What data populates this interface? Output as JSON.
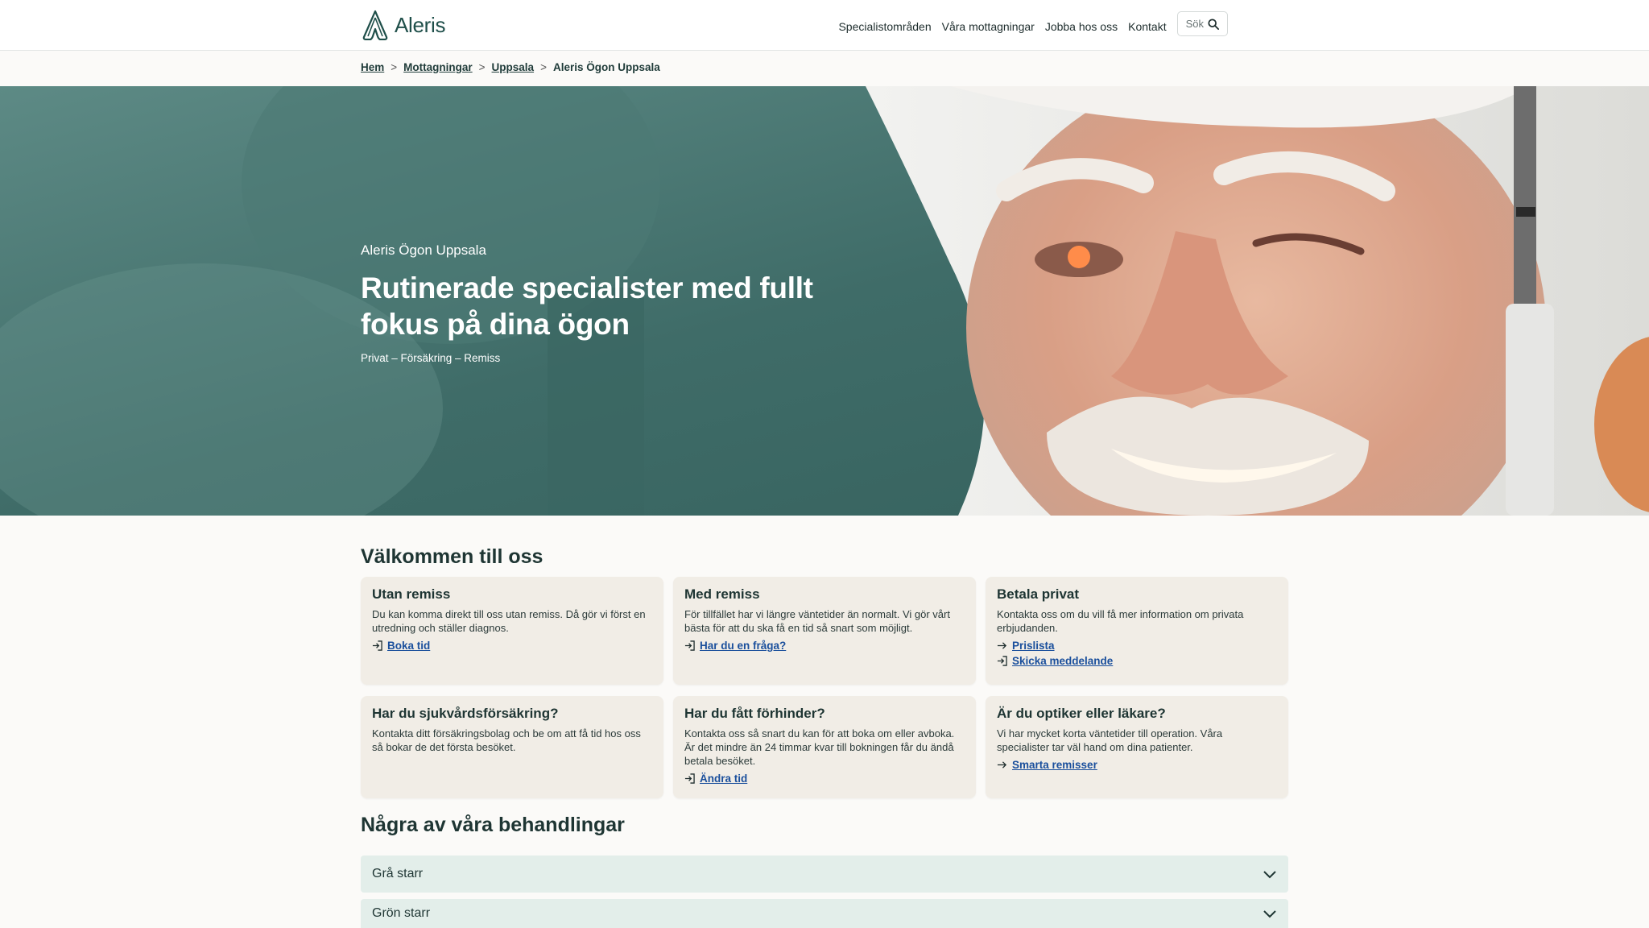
{
  "header": {
    "brand": "Aleris",
    "nav": [
      "Specialistområden",
      "Våra mottagningar",
      "Jobba hos oss",
      "Kontakt"
    ],
    "search_label": "Sök"
  },
  "breadcrumb": {
    "items": [
      "Hem",
      "Mottagningar",
      "Uppsala"
    ],
    "current": "Aleris Ögon Uppsala",
    "separator": ">"
  },
  "hero": {
    "eyebrow": "Aleris Ögon Uppsala",
    "title": "Rutinerade specialister med fullt fokus på dina ögon",
    "subtitle": "Privat – Försäkring – Remiss"
  },
  "welcome": {
    "title": "Välkommen till oss",
    "cards": [
      {
        "title": "Utan remiss",
        "text": "Du kan komma direkt till oss utan remiss. Då gör vi först en utredning och ställer diagnos.",
        "links": [
          "Boka tid"
        ]
      },
      {
        "title": "Med remiss",
        "text": "För tillfället har vi längre väntetider än normalt. Vi gör vårt bästa för att du ska få en tid så snart som möjligt.",
        "links": [
          "Har du en fråga?"
        ]
      },
      {
        "title": "Betala privat",
        "text": "Kontakta oss om du vill få mer information om privata erbjudanden.",
        "links": [
          "Prislista",
          "Skicka meddelande"
        ]
      },
      {
        "title": "Har du sjukvårdsförsäkring?",
        "text": "Kontakta ditt försäkringsbolag och be om att få tid hos oss så bokar de det första besöket.",
        "links": []
      },
      {
        "title": "Har du fått förhinder?",
        "text": "Kontakta oss så snart du kan för att boka om eller avboka. Är det mindre än 24 timmar kvar till bokningen får du ändå betala besöket.",
        "links": [
          "Ändra tid"
        ]
      },
      {
        "title": "Är du optiker eller läkare?",
        "text": "Vi har mycket korta väntetider till operation. Våra specialister tar väl hand om dina patienter.",
        "links": [
          "Smarta remisser"
        ]
      }
    ]
  },
  "treatments": {
    "title": "Några av våra behandlingar",
    "items": [
      "Grå starr",
      "Grön starr"
    ]
  },
  "colors": {
    "brand": "#1f4f4a",
    "hero_teal": "#2e5e5a",
    "card_bg": "#f1ede6",
    "link": "#1a4f9c",
    "accordion_bg": "#e3eeea"
  }
}
